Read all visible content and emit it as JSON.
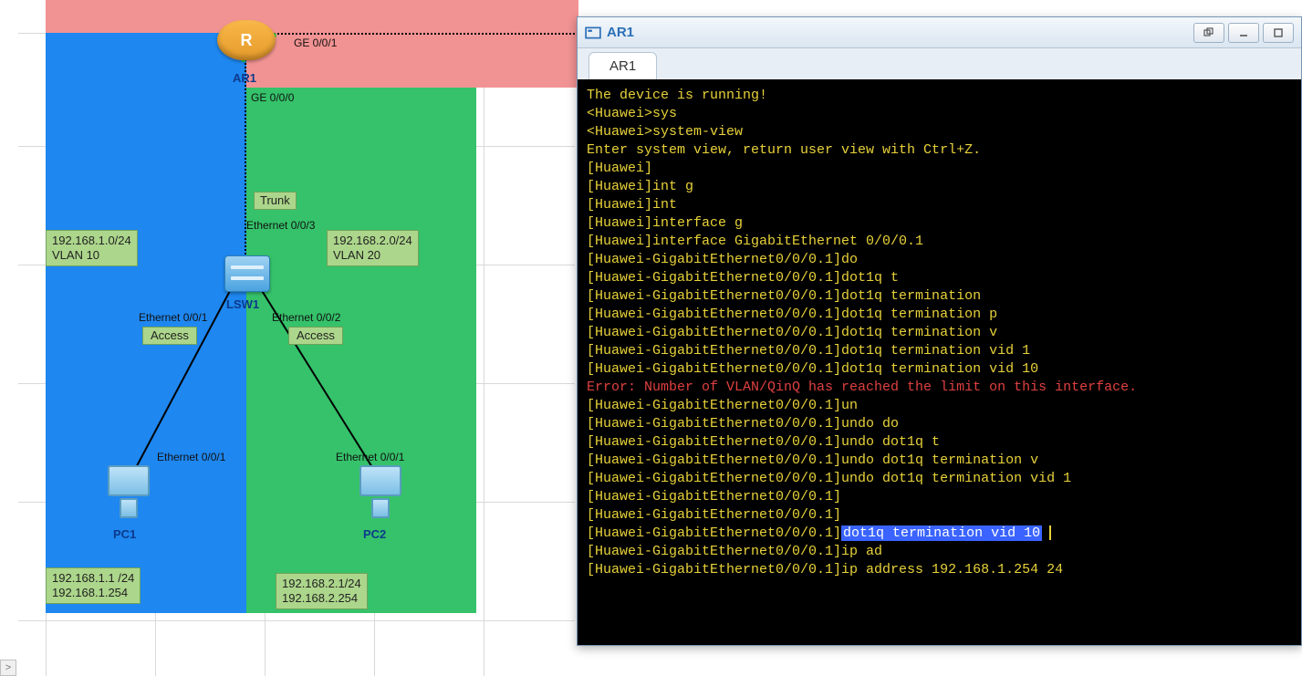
{
  "terminal": {
    "window_title": "AR1",
    "tab_label": "AR1",
    "lines": [
      {
        "t": "The device is running!"
      },
      {
        "t": ""
      },
      {
        "t": "<Huawei>sys"
      },
      {
        "t": "<Huawei>system-view"
      },
      {
        "t": "Enter system view, return user view with Ctrl+Z."
      },
      {
        "t": "[Huawei]"
      },
      {
        "t": "[Huawei]int g"
      },
      {
        "t": "[Huawei]int"
      },
      {
        "t": "[Huawei]interface g"
      },
      {
        "t": "[Huawei]interface GigabitEthernet 0/0/0.1"
      },
      {
        "t": "[Huawei-GigabitEthernet0/0/0.1]do"
      },
      {
        "t": "[Huawei-GigabitEthernet0/0/0.1]dot1q t"
      },
      {
        "t": "[Huawei-GigabitEthernet0/0/0.1]dot1q termination"
      },
      {
        "t": "[Huawei-GigabitEthernet0/0/0.1]dot1q termination p"
      },
      {
        "t": "[Huawei-GigabitEthernet0/0/0.1]dot1q termination v"
      },
      {
        "t": "[Huawei-GigabitEthernet0/0/0.1]dot1q termination vid 1"
      },
      {
        "t": "[Huawei-GigabitEthernet0/0/0.1]dot1q termination vid 10"
      },
      {
        "t": "Error: Number of VLAN/QinQ has reached the limit on this interface.",
        "cls": "err"
      },
      {
        "t": "[Huawei-GigabitEthernet0/0/0.1]un"
      },
      {
        "t": "[Huawei-GigabitEthernet0/0/0.1]undo do"
      },
      {
        "t": "[Huawei-GigabitEthernet0/0/0.1]undo dot1q t"
      },
      {
        "t": "[Huawei-GigabitEthernet0/0/0.1]undo dot1q termination v"
      },
      {
        "t": "[Huawei-GigabitEthernet0/0/0.1]undo dot1q termination vid 1"
      },
      {
        "t": "[Huawei-GigabitEthernet0/0/0.1]"
      },
      {
        "t": "[Huawei-GigabitEthernet0/0/0.1]"
      },
      {
        "prefix": "[Huawei-GigabitEthernet0/0/0.1]",
        "sel": "dot1q termination vid 10",
        "cursor": true
      },
      {
        "t": "[Huawei-GigabitEthernet0/0/0.1]ip ad"
      },
      {
        "t": "[Huawei-GigabitEthernet0/0/0.1]ip address 192.168.1.254 24"
      }
    ]
  },
  "topology": {
    "devices": {
      "ar1_label": "AR1",
      "router_letter": "R",
      "lsw1_label": "LSW1",
      "pc1_label": "PC1",
      "pc2_label": "PC2"
    },
    "ports": {
      "ge001": "GE 0/0/1",
      "ge000": "GE 0/0/0",
      "trunk": "Trunk",
      "eth003": "Ethernet 0/0/3",
      "eth001_up": "Ethernet 0/0/1",
      "access_l": "Access",
      "eth002_up": "Ethernet 0/0/2",
      "access_r": "Access",
      "eth001_pc1": "Ethernet 0/0/1",
      "eth001_pc2": "Ethernet 0/0/1"
    },
    "info": {
      "vlan10": "192.168.1.0/24\nVLAN 10",
      "vlan20": "192.168.2.0/24\nVLAN 20",
      "pc1": "192.168.1.1 /24\n192.168.1.254",
      "pc2": "192.168.2.1/24\n192.168.2.254"
    }
  },
  "corner_label": ">"
}
